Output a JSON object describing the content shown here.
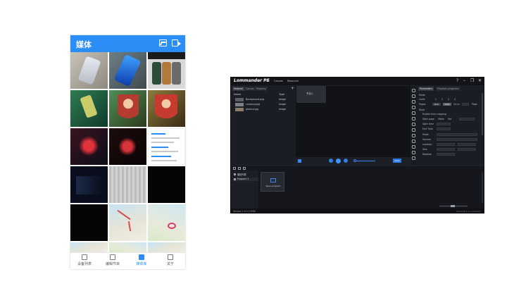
{
  "phone": {
    "title": "媒体",
    "header_icons": [
      "image-icon",
      "video-camera-icon"
    ],
    "tabs": [
      {
        "label": "设备列表",
        "icon": "list-icon"
      },
      {
        "label": "编辑节目",
        "icon": "edit-icon"
      },
      {
        "label": "媒体库",
        "icon": "folder-icon",
        "active": true
      },
      {
        "label": "关于",
        "icon": "document-icon"
      }
    ]
  },
  "app": {
    "logo": "Lommander PE",
    "menu": [
      "File",
      "Canvas",
      "Resource"
    ],
    "window_controls": [
      "?",
      "–",
      "❐",
      "✕"
    ],
    "media_tabs": [
      "Material",
      "Canvas",
      "Property"
    ],
    "add_label": "+",
    "columns": {
      "name": "Name",
      "type": "Type"
    },
    "files": [
      {
        "name": "Background.png",
        "type": "Image"
      },
      {
        "name": "company.jpg",
        "type": "Image"
      },
      {
        "name": "product.jpg",
        "type": "Image"
      }
    ],
    "preview_card_label": "节目1",
    "view_button": "View",
    "params": {
      "tabs": [
        "Parameters",
        "Playback programs"
      ],
      "mode_label": "Mode",
      "level_label": "Level",
      "pages_label": "Pages",
      "page_buttons": [
        "Prev",
        "Next",
        "Go to",
        "Page"
      ],
      "level_values": [
        "1",
        "2",
        "3",
        "4"
      ],
      "section": "Style",
      "enable_label": "Enable time cropping",
      "start_page_label": "Start page",
      "start_page_options": [
        "Static",
        "Set"
      ],
      "start_time_label": "Start time",
      "end_time_label": "End Time",
      "mode2_label": "Mode",
      "volume_label": "Volume",
      "location_label": "Location",
      "size_label": "Size",
      "rotation_label": "Rotation"
    },
    "timeline": {
      "items": [
        {
          "label": "播放列表"
        },
        {
          "label": "Program 1",
          "active": true
        }
      ],
      "card_label": "Save program"
    },
    "status": {
      "left": "Version 1.0.1.17089",
      "right": "Offset Not Accessibility"
    }
  }
}
